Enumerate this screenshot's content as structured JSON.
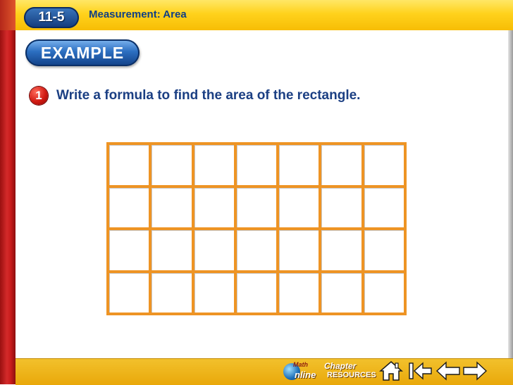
{
  "header": {
    "lesson_number": "11-5",
    "lesson_title": "Measurement: Area"
  },
  "example_label": "EXAMPLE",
  "question": {
    "number": "1",
    "text": "Write a formula to find the area of the rectangle."
  },
  "grid": {
    "columns": 7,
    "rows": 4,
    "line_color": "#ee9424"
  },
  "footer": {
    "math_online_top": "Math",
    "math_online_bottom": "nline",
    "chapter_resources_top": "Chapter",
    "chapter_resources_bottom": "RESOURCES",
    "icons": [
      "home-icon",
      "first-slide-icon",
      "previous-slide-icon",
      "next-slide-icon"
    ]
  },
  "colors": {
    "header_yellow": "#ffd21c",
    "title_blue": "#0f3f86",
    "question_blue": "#1b3f83",
    "side_red": "#c71b1b",
    "footer_gold": "#e9a80a"
  }
}
